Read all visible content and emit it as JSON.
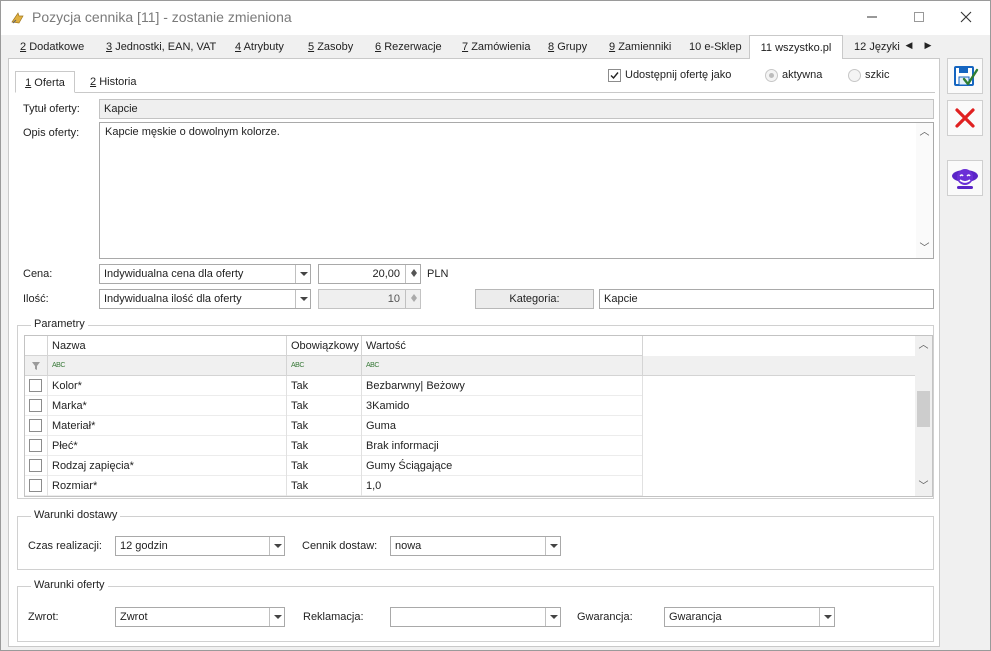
{
  "window": {
    "title": "Pozycja cennika [11] - zostanie zmieniona"
  },
  "main_tabs": [
    {
      "num": "2",
      "label": "Dodatkowe"
    },
    {
      "num": "3",
      "label": "Jednostki, EAN, VAT"
    },
    {
      "num": "4",
      "label": "Atrybuty"
    },
    {
      "num": "5",
      "label": "Zasoby"
    },
    {
      "num": "6",
      "label": "Rezerwacje"
    },
    {
      "num": "7",
      "label": "Zamówienia"
    },
    {
      "num": "8",
      "label": "Grupy"
    },
    {
      "num": "9",
      "label": "Zamienniki"
    },
    {
      "num": "10",
      "label": "e-Sklep"
    },
    {
      "num": "11",
      "label": "wszystko.pl"
    },
    {
      "num": "12",
      "label": "Języki"
    }
  ],
  "sub_tabs": [
    {
      "num": "1",
      "label": "Oferta"
    },
    {
      "num": "2",
      "label": "Historia"
    }
  ],
  "share": {
    "label": "Udostępnij ofertę jako",
    "checked": true,
    "option_active": "aktywna",
    "option_draft": "szkic"
  },
  "offer": {
    "title_label": "Tytuł oferty:",
    "title_value": "Kapcie",
    "desc_label": "Opis oferty:",
    "desc_value": "Kapcie męskie o dowolnym kolorze."
  },
  "price": {
    "label": "Cena:",
    "mode": "Indywidualna cena dla oferty",
    "value": "20,00",
    "currency": "PLN"
  },
  "quantity": {
    "label": "Ilość:",
    "mode": "Indywidualna ilość dla oferty",
    "value": "10"
  },
  "category": {
    "button_label": "Kategoria:",
    "value": "Kapcie"
  },
  "params": {
    "group_title": "Parametry",
    "columns": [
      "Nazwa",
      "Obowiązkowy",
      "Wartość"
    ],
    "filter_hint": "ABC",
    "rows": [
      {
        "name": "Kolor*",
        "required": "Tak",
        "value": "Bezbarwny| Beżowy"
      },
      {
        "name": "Marka*",
        "required": "Tak",
        "value": "3Kamido"
      },
      {
        "name": "Materiał*",
        "required": "Tak",
        "value": "Guma"
      },
      {
        "name": "Płeć*",
        "required": "Tak",
        "value": "Brak informacji"
      },
      {
        "name": "Rodzaj zapięcia*",
        "required": "Tak",
        "value": "Gumy Ściągające"
      },
      {
        "name": "Rozmiar*",
        "required": "Tak",
        "value": "1,0"
      }
    ]
  },
  "delivery": {
    "group_title": "Warunki dostawy",
    "time_label": "Czas realizacji:",
    "time_value": "12 godzin",
    "pricelist_label": "Cennik dostaw:",
    "pricelist_value": "nowa"
  },
  "conditions": {
    "group_title": "Warunki oferty",
    "return_label": "Zwrot:",
    "return_value": "Zwrot",
    "complaint_label": "Reklamacja:",
    "complaint_value": "",
    "warranty_label": "Gwarancja:",
    "warranty_value": "Gwarancja"
  },
  "toolbar": {
    "save_icon": "save-icon",
    "cancel_icon": "cancel-icon",
    "publish_icon": "wszystko-pl-icon"
  },
  "colors": {
    "save_accent": "#1e88e5",
    "cancel_red": "#e02020",
    "publish_purple": "#6b2fd6"
  }
}
